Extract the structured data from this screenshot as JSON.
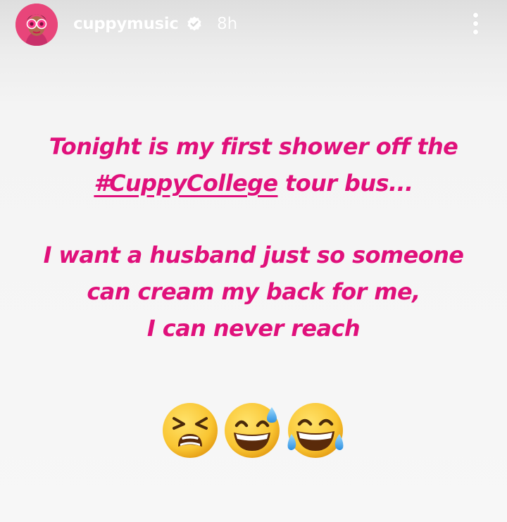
{
  "header": {
    "username": "cuppymusic",
    "timestamp": "8h",
    "verified_icon": "verified-badge-icon",
    "more_icon": "more-vertical-icon",
    "avatar_icon": "profile-avatar"
  },
  "story": {
    "paragraph1": {
      "line1": "Tonight is my first shower off the",
      "hashtag": "#CuppyCollege",
      "line2_rest": " tour bus..."
    },
    "paragraph2": {
      "line1": "I want a husband just so someone",
      "line2": "can cream my back for me,",
      "line3": "I can never reach"
    },
    "emojis": [
      "tired-face-icon",
      "grinning-sweat-icon",
      "tears-of-joy-icon"
    ]
  },
  "colors": {
    "text": "#e0107b",
    "background": "#f7f7f7",
    "header_text": "#ffffff",
    "emoji_yellow": "#f9c532"
  }
}
